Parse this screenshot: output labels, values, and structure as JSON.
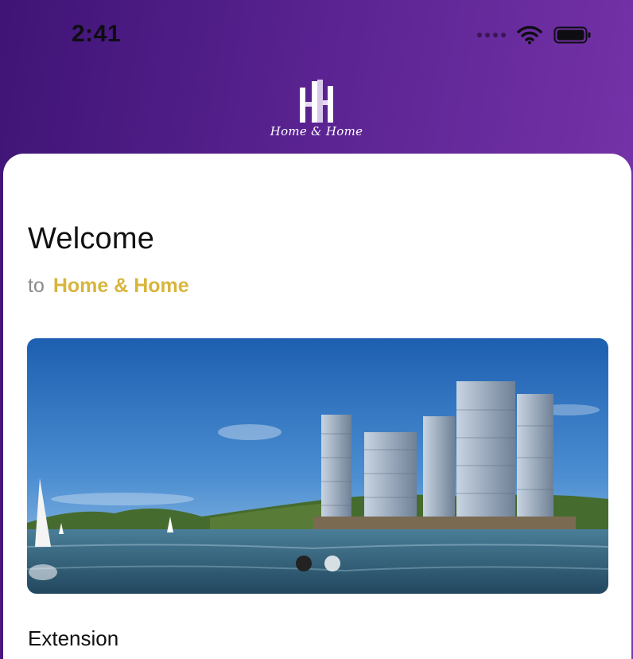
{
  "status_bar": {
    "time": "2:41",
    "icons": [
      "signal-dots-icon",
      "wifi-icon",
      "battery-icon"
    ]
  },
  "brand": {
    "logo_icon": "hh-buildings-logo-icon",
    "name": "Home & Home"
  },
  "welcome": {
    "title": "Welcome",
    "prefix": "to",
    "brand_name": "Home & Home"
  },
  "carousel": {
    "image": "coastal-resort-towers-photo",
    "slide_count": 2,
    "active_index": 0
  },
  "sections": {
    "extension_title": "Extension"
  },
  "colors": {
    "header_gradient_start": "#3f1476",
    "header_gradient_end": "#7b36ad",
    "accent_gold": "#d8b53c",
    "subtitle_gray": "#8a8a8a",
    "text_dark": "#111111"
  }
}
